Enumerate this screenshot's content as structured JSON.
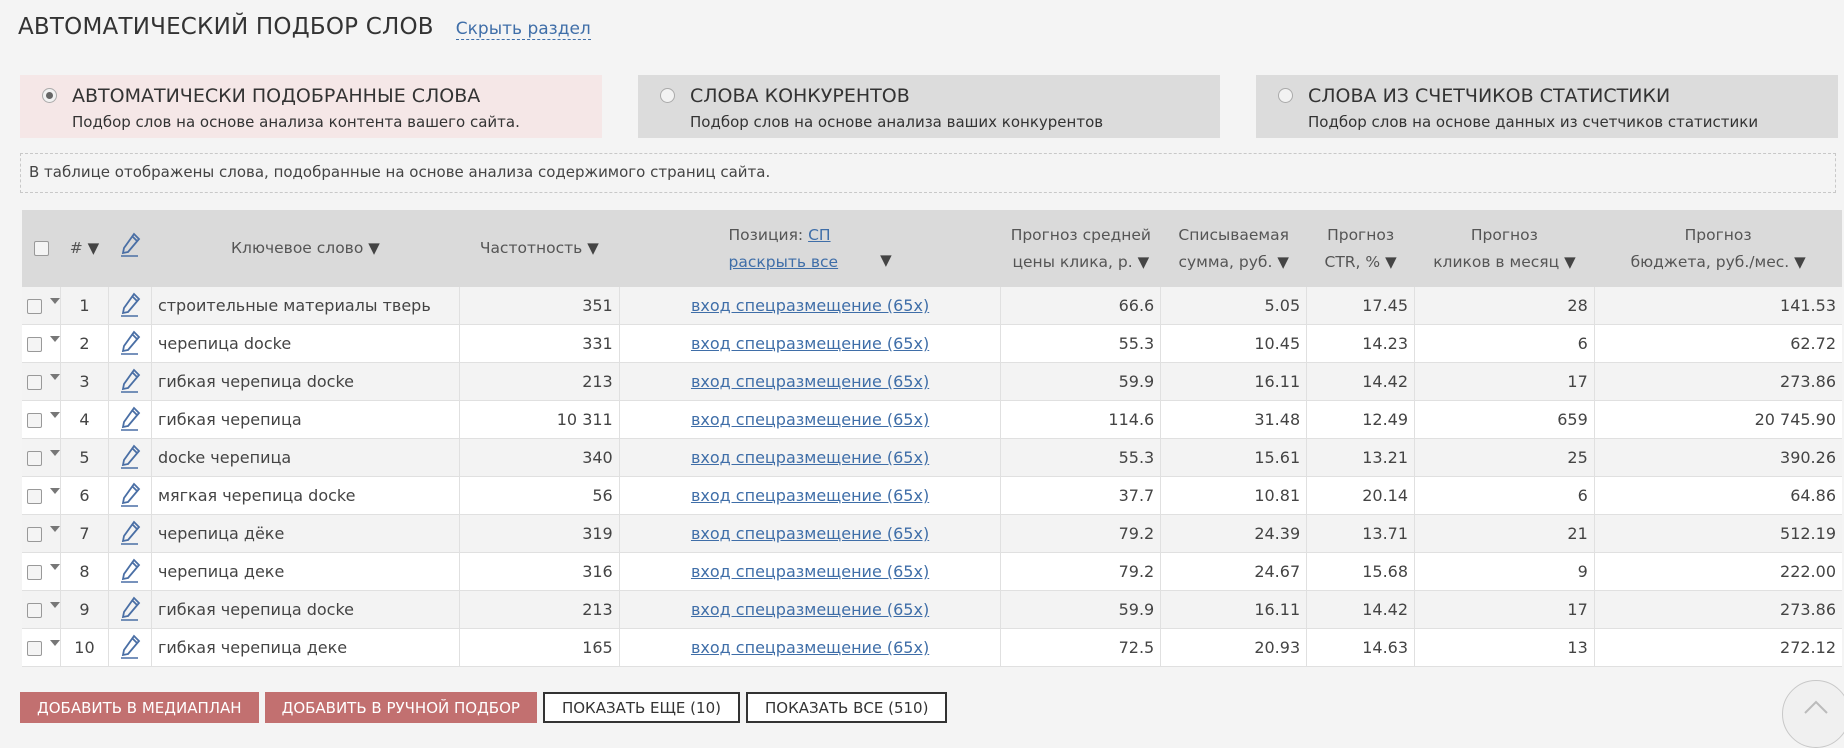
{
  "header": {
    "title": "АВТОМАТИЧЕСКИЙ ПОДБОР СЛОВ",
    "hide_link": "Скрыть раздел"
  },
  "tabs": [
    {
      "title": "АВТОМАТИЧЕСКИ ПОДОБРАННЫЕ СЛОВА",
      "subtitle": "Подбор слов на основе анализа контента вашего сайта.",
      "selected": true
    },
    {
      "title": "СЛОВА КОНКУРЕНТОВ",
      "subtitle": "Подбор слов на основе анализа ваших конкурентов",
      "selected": false
    },
    {
      "title": "СЛОВА ИЗ СЧЕТЧИКОВ СТАТИСТИКИ",
      "subtitle": "Подбор слов на основе данных из счетчиков статистики",
      "selected": false
    }
  ],
  "note": "В таблице отображены слова, подобранные на основе анализа содержимого страниц сайта.",
  "table": {
    "headers": {
      "num": "#",
      "keyword": "Ключевое слово",
      "frequency": "Частотность",
      "position": "Позиция:",
      "position_link": "СП",
      "expand_all": "раскрыть все",
      "cpc_l1": "Прогноз средней",
      "cpc_l2": "цены клика, р.",
      "charge_l1": "Списываемая",
      "charge_l2": "сумма, руб.",
      "ctr_l1": "Прогноз",
      "ctr_l2": "CTR, %",
      "clicks_l1": "Прогноз",
      "clicks_l2": "кликов в месяц",
      "budget_l1": "Прогноз",
      "budget_l2": "бюджета, руб./мес."
    },
    "sort_arrow": "▼",
    "rows": [
      {
        "n": "1",
        "keyword": "строительные материалы тверь",
        "freq": "351",
        "position": "вход спецразмещение (65x)",
        "cpc": "66.6",
        "charge": "5.05",
        "ctr": "17.45",
        "clicks": "28",
        "budget": "141.53"
      },
      {
        "n": "2",
        "keyword": "черепица docke",
        "freq": "331",
        "position": "вход спецразмещение (65x)",
        "cpc": "55.3",
        "charge": "10.45",
        "ctr": "14.23",
        "clicks": "6",
        "budget": "62.72"
      },
      {
        "n": "3",
        "keyword": "гибкая черепица docke",
        "freq": "213",
        "position": "вход спецразмещение (65x)",
        "cpc": "59.9",
        "charge": "16.11",
        "ctr": "14.42",
        "clicks": "17",
        "budget": "273.86"
      },
      {
        "n": "4",
        "keyword": "гибкая черепица",
        "freq": "10 311",
        "position": "вход спецразмещение (65x)",
        "cpc": "114.6",
        "charge": "31.48",
        "ctr": "12.49",
        "clicks": "659",
        "budget": "20 745.90"
      },
      {
        "n": "5",
        "keyword": "docke черепица",
        "freq": "340",
        "position": "вход спецразмещение (65x)",
        "cpc": "55.3",
        "charge": "15.61",
        "ctr": "13.21",
        "clicks": "25",
        "budget": "390.26"
      },
      {
        "n": "6",
        "keyword": "мягкая черепица docke",
        "freq": "56",
        "position": "вход спецразмещение (65x)",
        "cpc": "37.7",
        "charge": "10.81",
        "ctr": "20.14",
        "clicks": "6",
        "budget": "64.86"
      },
      {
        "n": "7",
        "keyword": "черепица дёке",
        "freq": "319",
        "position": "вход спецразмещение (65x)",
        "cpc": "79.2",
        "charge": "24.39",
        "ctr": "13.71",
        "clicks": "21",
        "budget": "512.19"
      },
      {
        "n": "8",
        "keyword": "черепица деке",
        "freq": "316",
        "position": "вход спецразмещение (65x)",
        "cpc": "79.2",
        "charge": "24.67",
        "ctr": "15.68",
        "clicks": "9",
        "budget": "222.00"
      },
      {
        "n": "9",
        "keyword": "гибкая черепица docke",
        "freq": "213",
        "position": "вход спецразмещение (65x)",
        "cpc": "59.9",
        "charge": "16.11",
        "ctr": "14.42",
        "clicks": "17",
        "budget": "273.86"
      },
      {
        "n": "10",
        "keyword": "гибкая черепица деке",
        "freq": "165",
        "position": "вход спецразмещение (65x)",
        "cpc": "72.5",
        "charge": "20.93",
        "ctr": "14.63",
        "clicks": "13",
        "budget": "272.12"
      }
    ]
  },
  "buttons": {
    "add_mediaplan": "ДОБАВИТЬ В МЕДИАПЛАН",
    "add_manual": "ДОБАВИТЬ В РУЧНОЙ ПОДБОР",
    "show_more": "ПОКАЗАТЬ ЕЩЕ (10)",
    "show_all": "ПОКАЗАТЬ ВСЕ (510)"
  },
  "colors": {
    "accent_red": "#c27070",
    "link": "#3f6ea8",
    "active_tab": "#f5e7e7",
    "inactive_tab": "#dcdcdc"
  },
  "icons": {
    "pencil": "pencil-icon",
    "scroll_top": "chevron-up-icon"
  }
}
